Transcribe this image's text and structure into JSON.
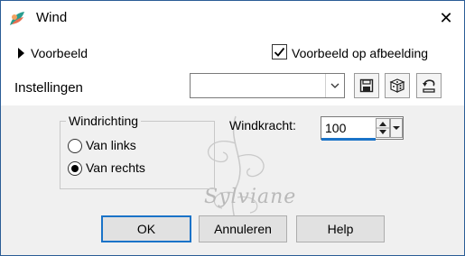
{
  "window": {
    "title": "Wind",
    "close_symbol": "✕"
  },
  "preview": {
    "toggle_label": "Voorbeeld",
    "checkbox_label": "Voorbeeld op afbeelding",
    "checkbox_checked": true
  },
  "settings": {
    "label": "Instellingen",
    "combo_value": ""
  },
  "wind_direction": {
    "title": "Windrichting",
    "options": [
      {
        "label": "Van links",
        "selected": false
      },
      {
        "label": "Van rechts",
        "selected": true
      }
    ]
  },
  "wind_strength": {
    "label": "Windkracht:",
    "value": "100"
  },
  "buttons": {
    "ok": "OK",
    "cancel": "Annuleren",
    "help": "Help"
  },
  "watermark": {
    "text": "Sylviane"
  },
  "colors": {
    "accent": "#1a73c8",
    "dialog_bg": "#f0f0f0",
    "border": "#2b5d96"
  },
  "icons": [
    "wind-app-icon",
    "close-icon",
    "expand-triangle-icon",
    "save-icon",
    "dice-icon",
    "reset-icon"
  ]
}
